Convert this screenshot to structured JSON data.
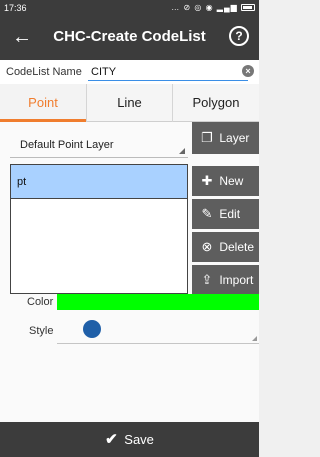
{
  "status_bar": {
    "time": "17:36",
    "icons": "… ⊘ ◎ ◉ ▂▄▆"
  },
  "header": {
    "title": "CHC-Create CodeList",
    "back_icon": "left-arrow",
    "help_icon": "question-circle",
    "help_glyph": "?"
  },
  "codelist_name": {
    "label": "CodeList Name",
    "value": "CITY",
    "clear_glyph": "×"
  },
  "tabs": [
    {
      "label": "Point",
      "active": true
    },
    {
      "label": "Line",
      "active": false
    },
    {
      "label": "Polygon",
      "active": false
    }
  ],
  "layer": {
    "selected": "Default Point Layer"
  },
  "buttons": {
    "layer": "Layer",
    "new": "New",
    "edit": "Edit",
    "delete": "Delete",
    "import": "Import"
  },
  "codes": [
    {
      "name": "pt",
      "selected": true
    }
  ],
  "properties": {
    "color_label": "Color",
    "color_value": "#00ff00",
    "style_label": "Style",
    "style_color": "#1f5fa8"
  },
  "footer": {
    "save_label": "Save"
  },
  "colors": {
    "bar": "#3c3c3c",
    "accent": "#f07d2e",
    "button": "#5e5e5e",
    "selection": "#a9d1ff"
  }
}
